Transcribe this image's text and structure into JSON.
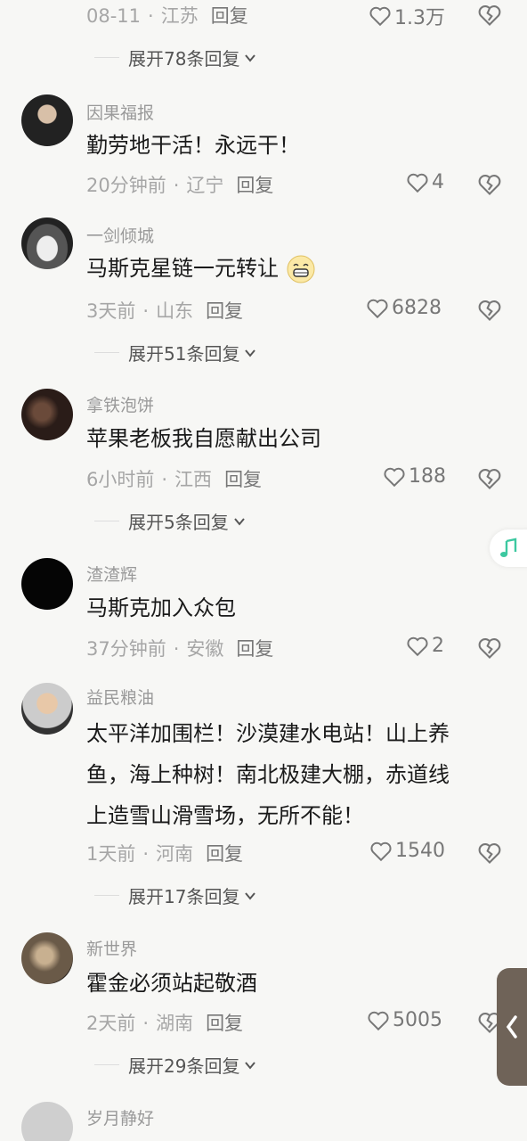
{
  "top_comment": {
    "date": "08-11",
    "location": "江苏",
    "reply": "回复",
    "likes": "1.3万",
    "expand": "展开78条回复"
  },
  "comments": [
    {
      "name": "因果福报",
      "text": [
        "勤劳地干活！永远干！"
      ],
      "time": "20分钟前",
      "location": "辽宁",
      "reply": "回复",
      "likes": "4",
      "expand": ""
    },
    {
      "name": "一剑倾城",
      "text": [
        "马斯克星链一元转让"
      ],
      "emoji": "grin-emoji",
      "time": "3天前",
      "location": "山东",
      "reply": "回复",
      "likes": "6828",
      "expand": "展开51条回复"
    },
    {
      "name": "拿铁泡饼",
      "text": [
        "苹果老板我自愿献出公司"
      ],
      "time": "6小时前",
      "location": "江西",
      "reply": "回复",
      "likes": "188",
      "expand": "展开5条回复"
    },
    {
      "name": "渣渣辉",
      "text": [
        "马斯克加入众包"
      ],
      "time": "37分钟前",
      "location": "安徽",
      "reply": "回复",
      "likes": "2",
      "expand": ""
    },
    {
      "name": "益民粮油",
      "text": [
        "太平洋加围栏！沙漠建水电站！山上养",
        "鱼，海上种树！南北极建大棚，赤道线",
        "上造雪山滑雪场，无所不能！"
      ],
      "time": "1天前",
      "location": "河南",
      "reply": "回复",
      "likes": "1540",
      "expand": "展开17条回复"
    },
    {
      "name": "新世界",
      "text": [
        "霍金必须站起敬酒"
      ],
      "time": "2天前",
      "location": "湖南",
      "reply": "回复",
      "likes": "5005",
      "expand": "展开29条回复"
    },
    {
      "name": "岁月静好",
      "text": [],
      "time": "",
      "location": "",
      "reply": "",
      "likes": "",
      "expand": ""
    }
  ],
  "icons": {
    "like": "heart-icon",
    "dislike": "broken-heart-icon",
    "expand": "chevron-down-icon",
    "music": "music-note-icon",
    "collapse": "chevron-left-icon"
  },
  "colors": {
    "background": "#f7f7f5",
    "music_note": "#3cc8a0",
    "side_tab": "#6f6358"
  }
}
